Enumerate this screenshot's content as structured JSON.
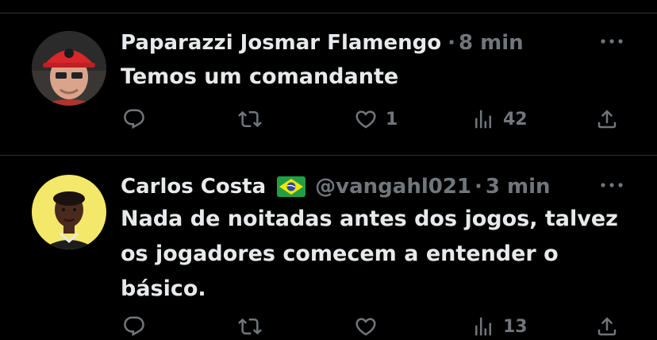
{
  "tweets": [
    {
      "name": "Paparazzi Josmar Flamengo",
      "handle": "",
      "separator": "·",
      "time": "8 min",
      "text": "Temos um comandante",
      "replies": "",
      "retweets": "",
      "likes": "1",
      "views": "42"
    },
    {
      "name": "Carlos Costa",
      "flag": "brazil-flag",
      "handle": "@vangahl021",
      "separator": "·",
      "time": "3 min",
      "text_lines": [
        "Nada de noitadas antes dos jogos, talvez",
        "os jogadores comecem a entender o",
        "básico."
      ],
      "replies": "",
      "retweets": "",
      "likes": "",
      "views": "13"
    }
  ],
  "icons": {
    "reply": "reply-icon",
    "retweet": "retweet-icon",
    "like": "heart-icon",
    "views": "views-icon",
    "share": "share-icon",
    "more": "more-icon"
  },
  "colors": {
    "background": "#000000",
    "text": "#e7e9ea",
    "muted": "#71767b",
    "divider": "#2f3336"
  }
}
